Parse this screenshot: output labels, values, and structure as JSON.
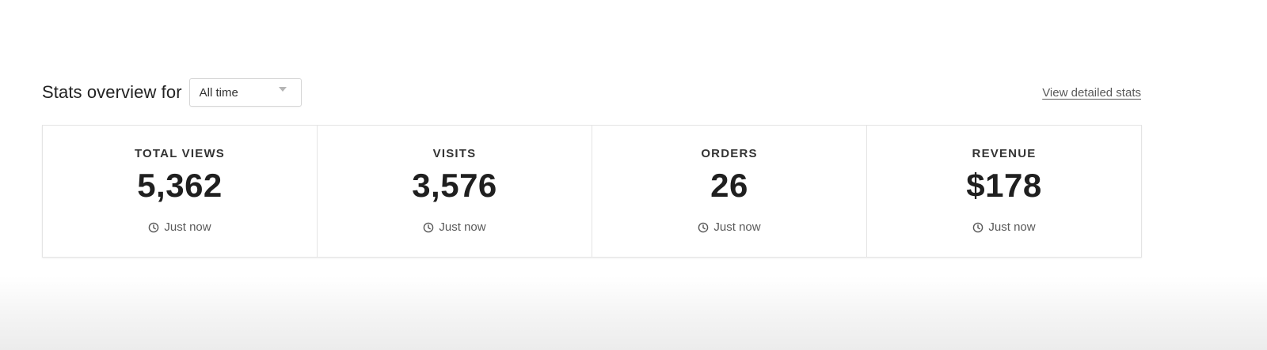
{
  "header": {
    "title": "Stats overview for",
    "period_select": {
      "value": "All time"
    },
    "detail_link": "View detailed stats"
  },
  "stats": [
    {
      "label": "TOTAL VIEWS",
      "value": "5,362",
      "updated": "Just now",
      "icon": "clock-icon"
    },
    {
      "label": "VISITS",
      "value": "3,576",
      "updated": "Just now",
      "icon": "clock-icon"
    },
    {
      "label": "ORDERS",
      "value": "26",
      "updated": "Just now",
      "icon": "clock-icon"
    },
    {
      "label": "REVENUE",
      "value": "$178",
      "updated": "Just now",
      "icon": "clock-icon"
    }
  ],
  "colors": {
    "text": "#222222",
    "muted_text": "#595959",
    "border": "#e4e4e4"
  }
}
